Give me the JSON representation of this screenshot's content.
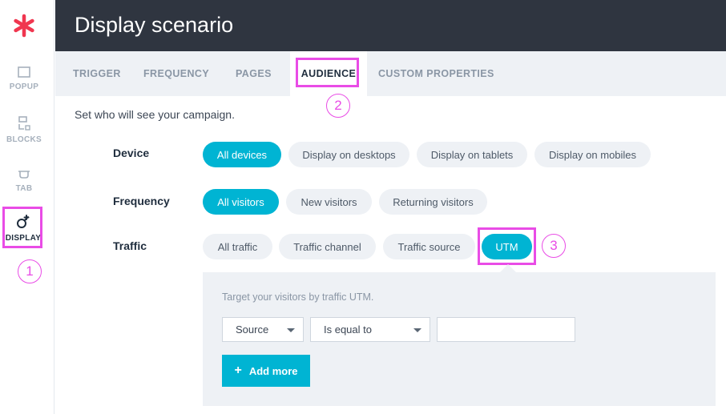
{
  "header": {
    "title": "Display scenario"
  },
  "sidebar": {
    "items": [
      {
        "label": "POPUP",
        "icon": "popup-icon"
      },
      {
        "label": "BLOCKS",
        "icon": "blocks-icon"
      },
      {
        "label": "TAB",
        "icon": "tab-icon"
      },
      {
        "label": "DISPLAY",
        "icon": "display-icon",
        "active": true
      }
    ]
  },
  "tabs": [
    {
      "label": "TRIGGER"
    },
    {
      "label": "FREQUENCY"
    },
    {
      "label": "PAGES"
    },
    {
      "label": "AUDIENCE",
      "active": true
    },
    {
      "label": "CUSTOM PROPERTIES"
    }
  ],
  "intro": "Set who will see your campaign.",
  "device": {
    "label": "Device",
    "options": [
      "All devices",
      "Display on desktops",
      "Display on tablets",
      "Display on mobiles"
    ],
    "selected": "All devices"
  },
  "frequency": {
    "label": "Frequency",
    "options": [
      "All visitors",
      "New visitors",
      "Returning visitors"
    ],
    "selected": "All visitors"
  },
  "traffic": {
    "label": "Traffic",
    "options": [
      "All traffic",
      "Traffic channel",
      "Traffic source",
      "UTM"
    ],
    "selected": "UTM"
  },
  "utm_panel": {
    "description": "Target your visitors by traffic UTM.",
    "param_select": "Source",
    "operator_select": "Is equal to",
    "value_input": "",
    "add_more": "Add more"
  },
  "annotations": {
    "one": "1",
    "two": "2",
    "three": "3"
  },
  "colors": {
    "accent": "#00b4d3",
    "header": "#2f3540",
    "highlight": "#e94ce6",
    "logo": "#f0364f"
  }
}
